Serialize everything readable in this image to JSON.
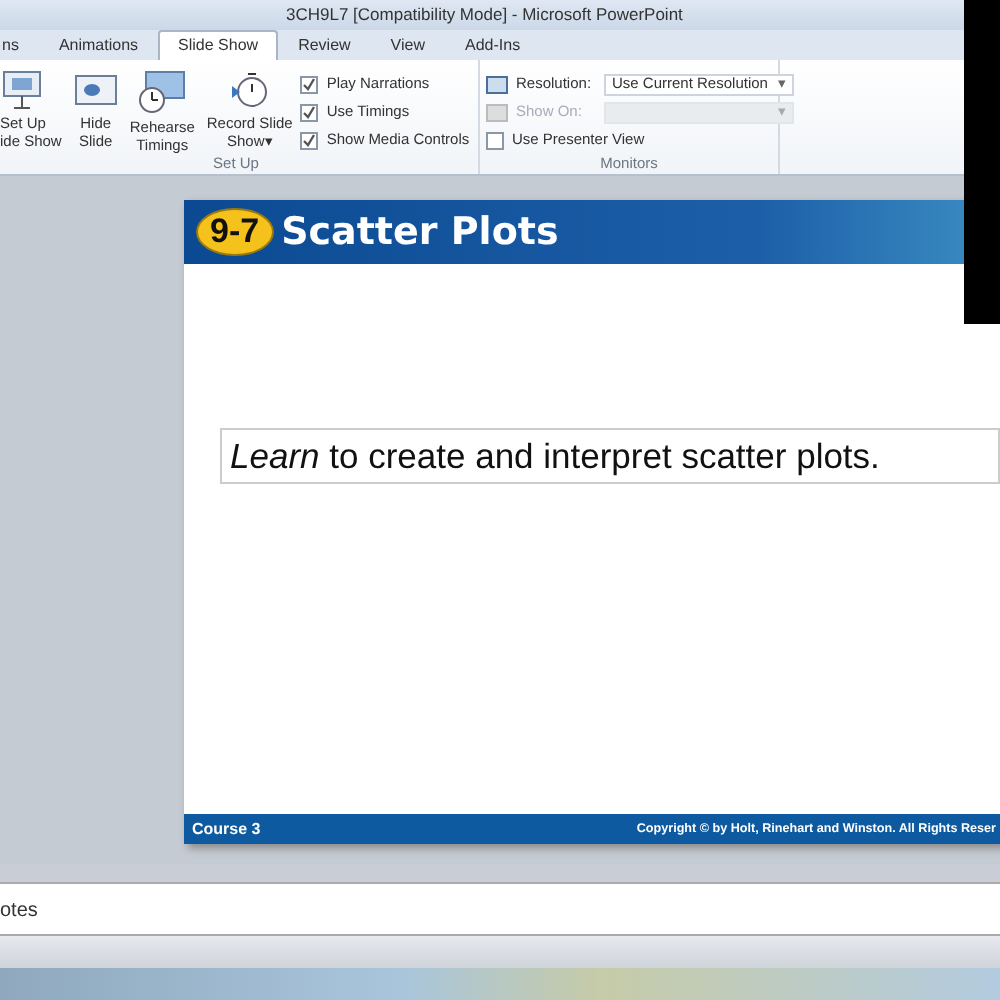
{
  "window": {
    "title": "3CH9L7 [Compatibility Mode] - Microsoft PowerPoint"
  },
  "tabs": [
    {
      "label": "ns",
      "selected": false
    },
    {
      "label": "Animations",
      "selected": false
    },
    {
      "label": "Slide Show",
      "selected": true
    },
    {
      "label": "Review",
      "selected": false
    },
    {
      "label": "View",
      "selected": false
    },
    {
      "label": "Add-Ins",
      "selected": false
    }
  ],
  "ribbon": {
    "groups": [
      {
        "kind": "setup",
        "label": "Set Up",
        "buttons": [
          {
            "lines": [
              "Set Up",
              "ide Show"
            ]
          },
          {
            "lines": [
              "Hide",
              "Slide"
            ]
          },
          {
            "lines": [
              "Rehearse",
              "Timings"
            ]
          },
          {
            "lines": [
              "Record Slide",
              "Show"
            ],
            "caret": "▾"
          }
        ],
        "checkboxes": [
          {
            "label": "Play Narrations",
            "checked": true
          },
          {
            "label": "Use Timings",
            "checked": true
          },
          {
            "label": "Show Media Controls",
            "checked": true
          }
        ]
      },
      {
        "kind": "monitors",
        "label": "Monitors",
        "fields": [
          {
            "label": "Resolution:",
            "value": "Use Current Resolution",
            "caret": "▾",
            "disabled": false
          },
          {
            "label": "Show On:",
            "caret": "▾",
            "disabled": true
          }
        ],
        "checkboxes": [
          {
            "label": "Use Presenter View",
            "checked": false
          }
        ]
      }
    ]
  },
  "slide": {
    "badge": "9-7",
    "title": "Scatter Plots",
    "body": "*Learn* to create and interpret scatter plots.",
    "footer_left": "Course 3",
    "footer_right": "Copyright © by Holt, Rinehart and Winston. All Rights Reser"
  },
  "notes": {
    "text": "otes"
  }
}
